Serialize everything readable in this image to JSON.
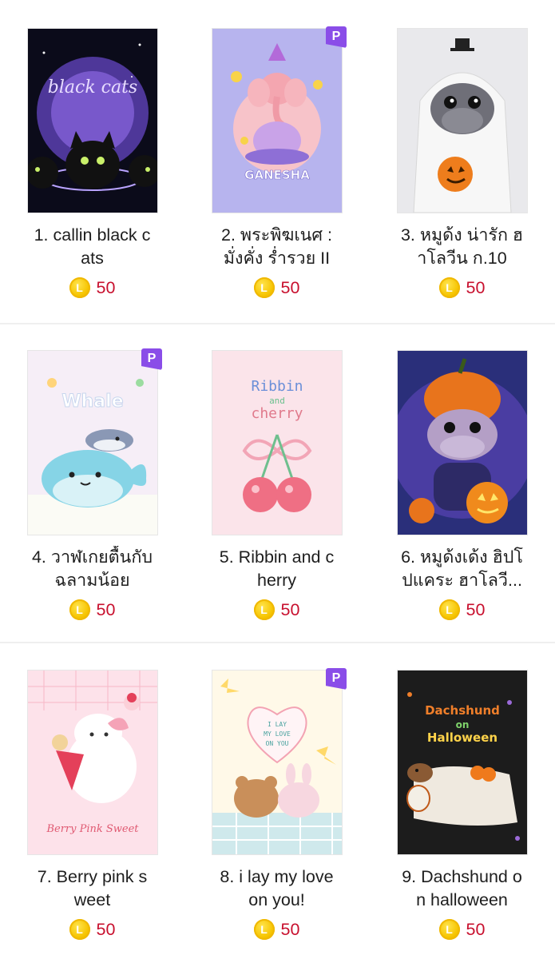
{
  "currency_icon": "line-coin-icon",
  "currency_symbol": "L",
  "colors": {
    "premium_badge": "#8a4de8",
    "price": "#c8102e",
    "coin": "#f6c400",
    "divider": "#efefef"
  },
  "items": [
    {
      "title": "1. callin black c\nats",
      "price": "50",
      "premium": false,
      "badge": "",
      "thumb_text": "black cats",
      "theme": "black-cats"
    },
    {
      "title": "2. พระพิฆเนศ :\nมั่งคั่ง ร่ำรวย II",
      "price": "50",
      "premium": true,
      "badge": "P",
      "thumb_text": "GANESHA",
      "theme": "ganesha"
    },
    {
      "title": "3. หมูด้ง น่ารัก ฮ\nาโลวีน ก.10",
      "price": "50",
      "premium": false,
      "badge": "",
      "thumb_text": "",
      "theme": "hippo-ghost"
    },
    {
      "title": "4. วาฬเกยตื้นกับ\nฉลามน้อย",
      "price": "50",
      "premium": true,
      "badge": "P",
      "thumb_text": "Whale",
      "theme": "whale"
    },
    {
      "title": "5. Ribbin and c\nherry",
      "price": "50",
      "premium": false,
      "badge": "",
      "thumb_text": "Ribbin and cherry",
      "theme": "ribbon-cherry"
    },
    {
      "title": "6. หมูด้งเด้ง ฮิปโ\nปแคระ ฮาโลวี...",
      "price": "50",
      "premium": false,
      "badge": "",
      "thumb_text": "",
      "theme": "hippo-pumpkin"
    },
    {
      "title": "7. Berry pink s\nweet",
      "price": "50",
      "premium": false,
      "badge": "",
      "thumb_text": "Berry Pink Sweet",
      "theme": "berry-pink"
    },
    {
      "title": "8. i lay my love\non you!",
      "price": "50",
      "premium": true,
      "badge": "P",
      "thumb_text": "I LAY MY LOVE ON YOU",
      "theme": "love-bears"
    },
    {
      "title": "9. Dachshund o\nn halloween",
      "price": "50",
      "premium": false,
      "badge": "",
      "thumb_text": "Dachshund on Halloween",
      "theme": "dachshund"
    }
  ]
}
